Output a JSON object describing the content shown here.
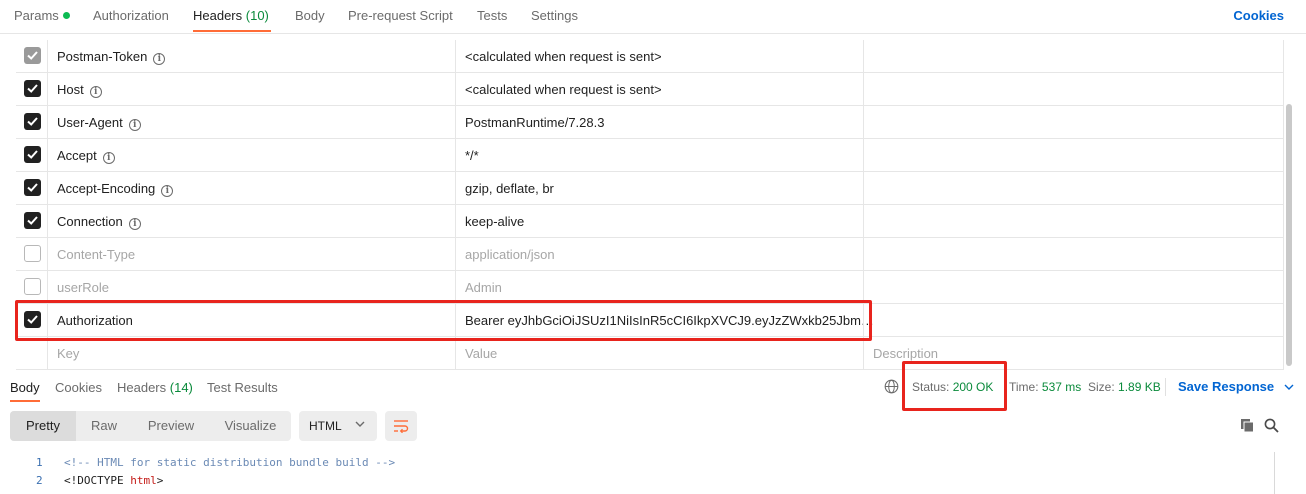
{
  "request_tabs": [
    {
      "label": "Params",
      "count": ""
    },
    {
      "label": "Authorization",
      "count": ""
    },
    {
      "label": "Headers",
      "count": "(10)"
    },
    {
      "label": "Body",
      "count": ""
    },
    {
      "label": "Pre-request Script",
      "count": ""
    },
    {
      "label": "Tests",
      "count": ""
    },
    {
      "label": "Settings",
      "count": ""
    }
  ],
  "cookies_label": "Cookies",
  "headers": [
    {
      "key": "Postman-Token",
      "value": "<calculated when request is sent>",
      "state": "locked"
    },
    {
      "key": "Host",
      "value": "<calculated when request is sent>",
      "state": "on"
    },
    {
      "key": "User-Agent",
      "value": "PostmanRuntime/7.28.3",
      "state": "on"
    },
    {
      "key": "Accept",
      "value": "*/*",
      "state": "on"
    },
    {
      "key": "Accept-Encoding",
      "value": "gzip, deflate, br",
      "state": "on"
    },
    {
      "key": "Connection",
      "value": "keep-alive",
      "state": "on"
    },
    {
      "key": "Content-Type",
      "value": "application/json",
      "state": "off"
    },
    {
      "key": "userRole",
      "value": "Admin",
      "state": "off"
    },
    {
      "key": "Authorization",
      "value": "Bearer eyJhbGciOiJSUzI1NiIsInR5cCI6IkpXVCJ9.eyJzZWxkb25Jbm…",
      "state": "on"
    }
  ],
  "new_row": {
    "key_placeholder": "Key",
    "value_placeholder": "Value",
    "desc_placeholder": "Description"
  },
  "response_tabs": [
    {
      "label": "Body",
      "count": ""
    },
    {
      "label": "Cookies",
      "count": ""
    },
    {
      "label": "Headers",
      "count": "(14)"
    },
    {
      "label": "Test Results",
      "count": ""
    }
  ],
  "response_meta": {
    "status_label": "Status:",
    "status_value": "200 OK",
    "time_label": "Time:",
    "time_value": "537 ms",
    "size_label": "Size:",
    "size_value": "1.89 KB",
    "save_label": "Save Response"
  },
  "format_modes": [
    "Pretty",
    "Raw",
    "Preview",
    "Visualize"
  ],
  "language": "HTML",
  "code_lines": [
    {
      "num": "1",
      "comment": "<!-- HTML for static distribution bundle build -->"
    },
    {
      "num": "2",
      "prefix": "<!DOCTYPE ",
      "keyword": "html",
      "suffix": ">"
    }
  ],
  "colors": {
    "accent": "#ff6c37",
    "link": "#0265d2",
    "success": "#0a8a3b",
    "highlight": "#e8241d"
  }
}
